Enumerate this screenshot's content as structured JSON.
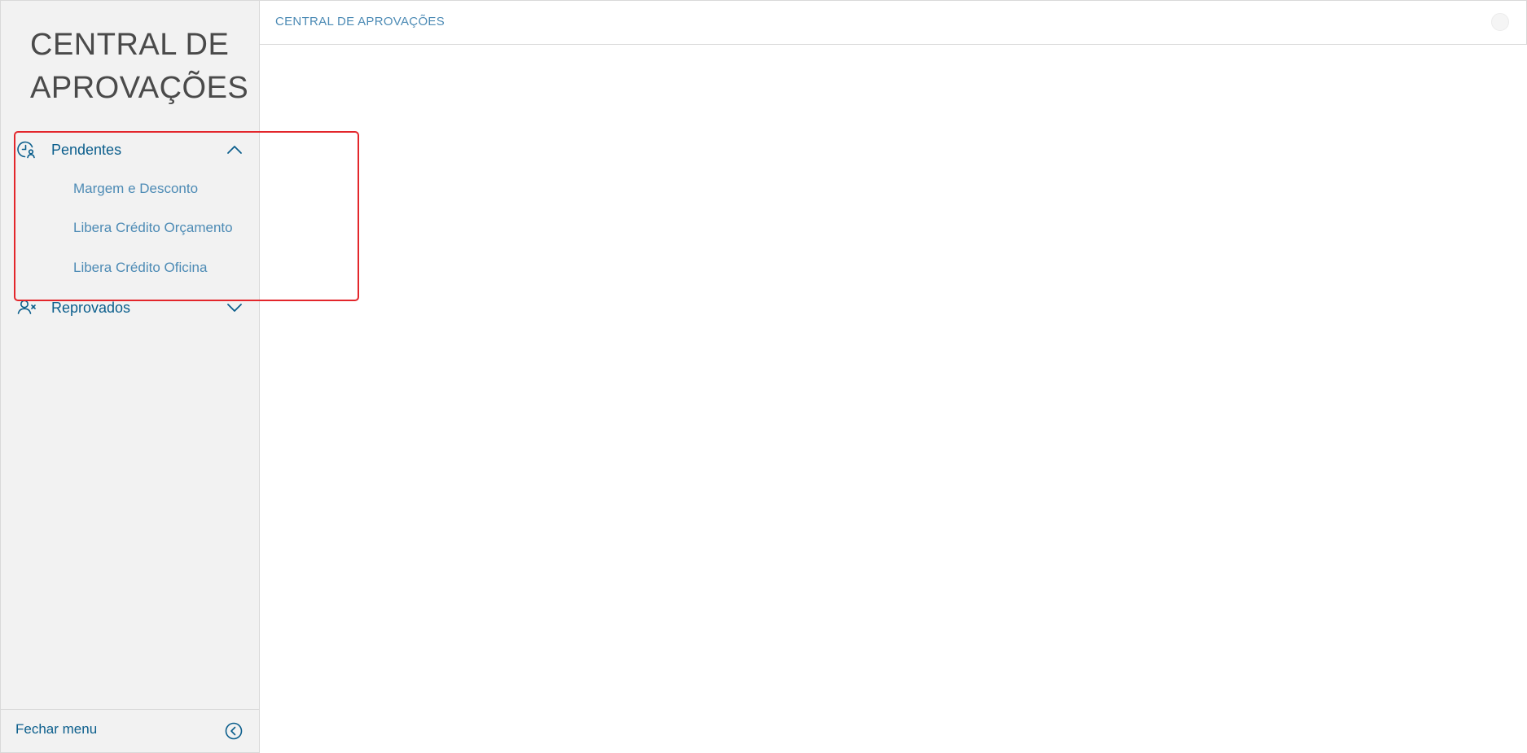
{
  "sidebar": {
    "title": "CENTRAL DE APROVAÇÕES",
    "groups": [
      {
        "label": "Pendentes",
        "icon": "clock-user-icon",
        "expanded": true,
        "items": [
          {
            "label": "Margem e Desconto"
          },
          {
            "label": "Libera Crédito Orçamento"
          },
          {
            "label": "Libera Crédito Oficina"
          }
        ]
      },
      {
        "label": "Reprovados",
        "icon": "user-x-icon",
        "expanded": false,
        "items": []
      }
    ],
    "footer": {
      "label": "Fechar menu",
      "icon": "chevron-left-circle-icon"
    }
  },
  "header": {
    "breadcrumb": "CENTRAL DE APROVAÇÕES"
  },
  "colors": {
    "primary": "#0b5e8c",
    "link": "#4d8bb5",
    "sidebar_bg": "#f2f2f2",
    "highlight": "#e3262b"
  }
}
